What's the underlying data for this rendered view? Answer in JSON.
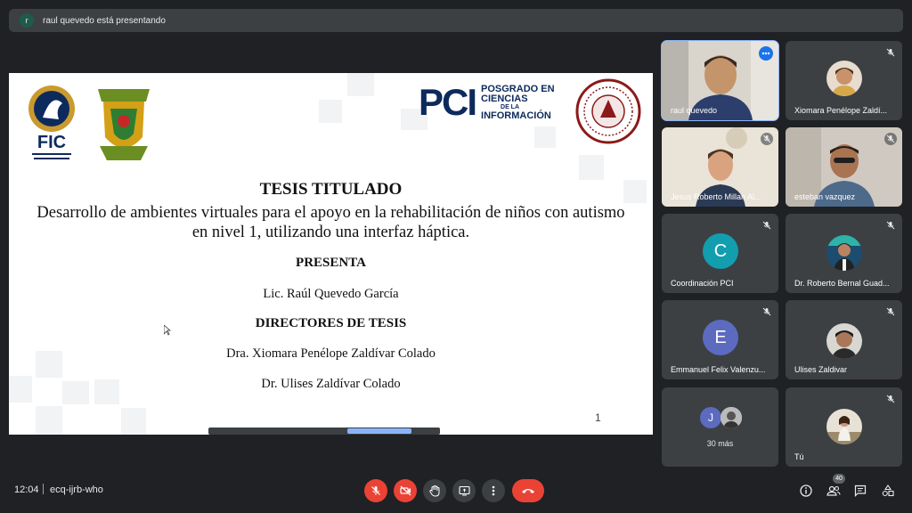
{
  "top_bar": {
    "presenter_initial": "r",
    "status": "raul quevedo está presentando"
  },
  "slide": {
    "pci_logo": "PCI",
    "pci_sub_line1": "POSGRADO EN",
    "pci_sub_line2": "CIENCIAS",
    "pci_sub_line3": "DE LA",
    "pci_sub_line4": "INFORMACIÓN",
    "fic_logo": "FIC",
    "title": "TESIS TITULADO",
    "description": "Desarrollo de ambientes virtuales para el apoyo en la rehabilitación de niños con autismo en nivel 1, utilizando una interfaz háptica.",
    "presenta_label": "PRESENTA",
    "presenter_name": "Lic. Raúl Quevedo García",
    "directors_label": "DIRECTORES DE TESIS",
    "director_1": "Dra. Xiomara Penélope Zaldívar Colado",
    "director_2": "Dr. Ulises Zaldívar Colado",
    "page_number": "1"
  },
  "participants": [
    {
      "name": "raul quevedo",
      "type": "video",
      "active": true
    },
    {
      "name": "Xiomara Penélope Zaldí...",
      "type": "photo",
      "muted": true
    },
    {
      "name": "Jesus Roberto Millan Al...",
      "type": "video",
      "muted": true
    },
    {
      "name": "esteban vazquez",
      "type": "video",
      "muted": true
    },
    {
      "name": "Coordinación PCI",
      "type": "letter",
      "letter": "C",
      "color": "#129eaf",
      "muted": true
    },
    {
      "name": "Dr. Roberto Bernal Guad...",
      "type": "photo",
      "muted": true
    },
    {
      "name": "Emmanuel Felix Valenzu...",
      "type": "letter",
      "letter": "E",
      "color": "#5c6bc0",
      "muted": true
    },
    {
      "name": "Ulises Zaldivar",
      "type": "photo",
      "muted": true
    },
    {
      "name": "30 más",
      "type": "more",
      "letter": "J",
      "color": "#5c6bc0"
    },
    {
      "name": "Tú",
      "type": "photo",
      "muted": true
    }
  ],
  "bottom_bar": {
    "time": "12:04",
    "meeting_code": "ecq-ijrb-who",
    "people_count": "40"
  },
  "colors": {
    "background": "#202124",
    "tile": "#3c4043",
    "red": "#ea4335",
    "accent_blue": "#8ab4f8"
  },
  "icons": [
    "mic-off-icon",
    "camera-off-icon",
    "raise-hand-icon",
    "present-icon",
    "more-vert-icon",
    "end-call-icon",
    "info-icon",
    "people-icon",
    "chat-icon",
    "activities-icon"
  ]
}
